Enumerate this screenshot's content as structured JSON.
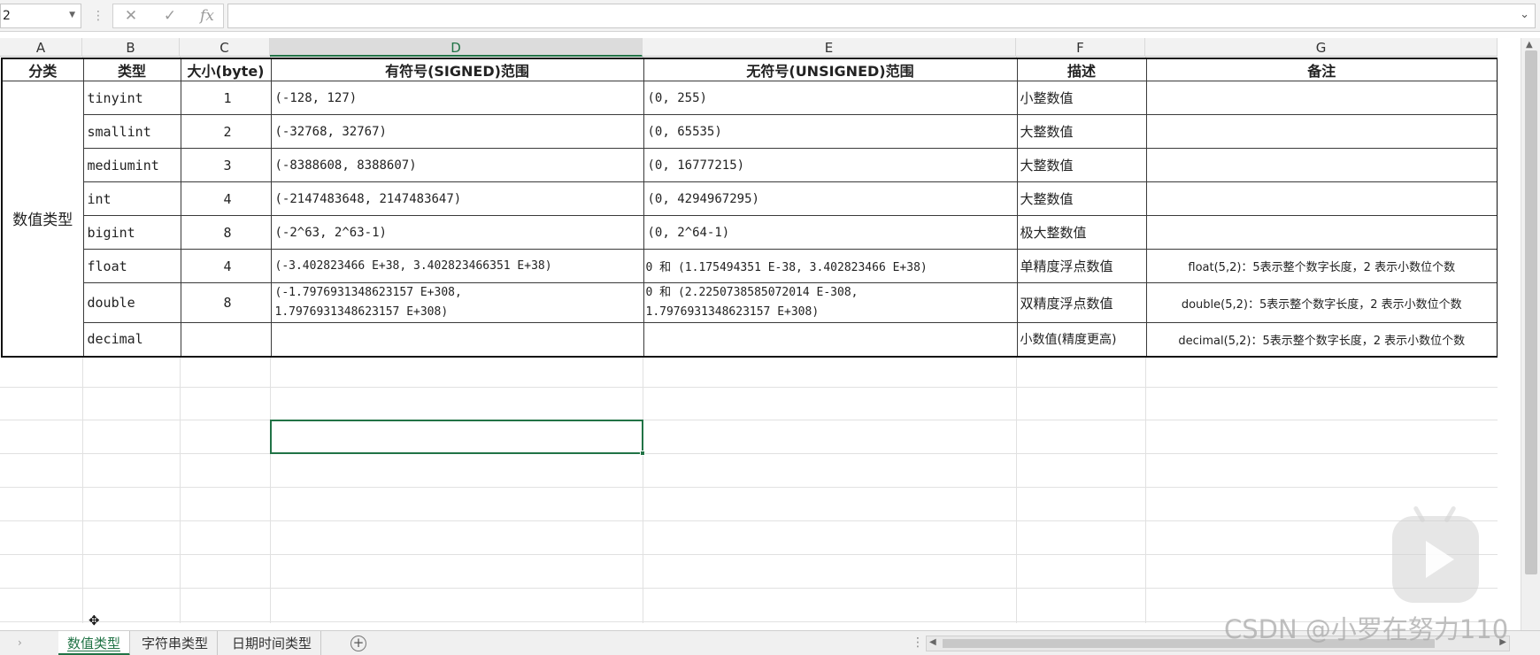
{
  "formula_bar": {
    "name_box": "2",
    "cancel_icon": "✕",
    "enter_icon": "✓",
    "fx_label": "fx",
    "formula_value": ""
  },
  "columns": [
    "A",
    "B",
    "C",
    "D",
    "E",
    "F",
    "G"
  ],
  "table": {
    "headers": [
      "分类",
      "类型",
      "大小(byte)",
      "有符号(SIGNED)范围",
      "无符号(UNSIGNED)范围",
      "描述",
      "备注"
    ],
    "category": "数值类型",
    "rows": [
      {
        "type": "tinyint",
        "size": "1",
        "signed": "(-128, 127)",
        "unsigned": "(0, 255)",
        "desc": "小整数值",
        "note": ""
      },
      {
        "type": "smallint",
        "size": "2",
        "signed": "(-32768, 32767)",
        "unsigned": "(0, 65535)",
        "desc": "大整数值",
        "note": ""
      },
      {
        "type": "mediumint",
        "size": "3",
        "signed": "(-8388608, 8388607)",
        "unsigned": "(0, 16777215)",
        "desc": "大整数值",
        "note": ""
      },
      {
        "type": "int",
        "size": "4",
        "signed": "(-2147483648, 2147483647)",
        "unsigned": "(0, 4294967295)",
        "desc": "大整数值",
        "note": ""
      },
      {
        "type": "bigint",
        "size": "8",
        "signed": "(-2^63, 2^63-1)",
        "unsigned": "(0, 2^64-1)",
        "desc": "极大整数值",
        "note": ""
      },
      {
        "type": "float",
        "size": "4",
        "signed": "(-3.402823466 E+38, 3.402823466351 E+38)",
        "unsigned": "0 和 (1.175494351 E-38, 3.402823466 E+38)",
        "desc": "单精度浮点数值",
        "note": "float(5,2)：5表示整个数字长度，2 表示小数位个数"
      },
      {
        "type": "double",
        "size": "8",
        "signed": "(-1.7976931348623157 E+308,",
        "signed2": "1.7976931348623157 E+308)",
        "unsigned": "0 和 (2.2250738585072014 E-308,",
        "unsigned2": "1.7976931348623157 E+308)",
        "desc": "双精度浮点数值",
        "note": "double(5,2)：5表示整个数字长度，2 表示小数位个数"
      },
      {
        "type": "decimal",
        "size": "",
        "signed": "",
        "unsigned": "",
        "desc": "小数值(精度更高)",
        "note": "decimal(5,2)：5表示整个数字长度，2 表示小数位个数"
      }
    ]
  },
  "sheet_tabs": [
    "数值类型",
    "字符串类型",
    "日期时间类型"
  ],
  "active_tab": "数值类型",
  "add_sheet_icon": "plus-circle-icon",
  "watermark": "CSDN @小罗在努力110",
  "accent_color": "#217346"
}
